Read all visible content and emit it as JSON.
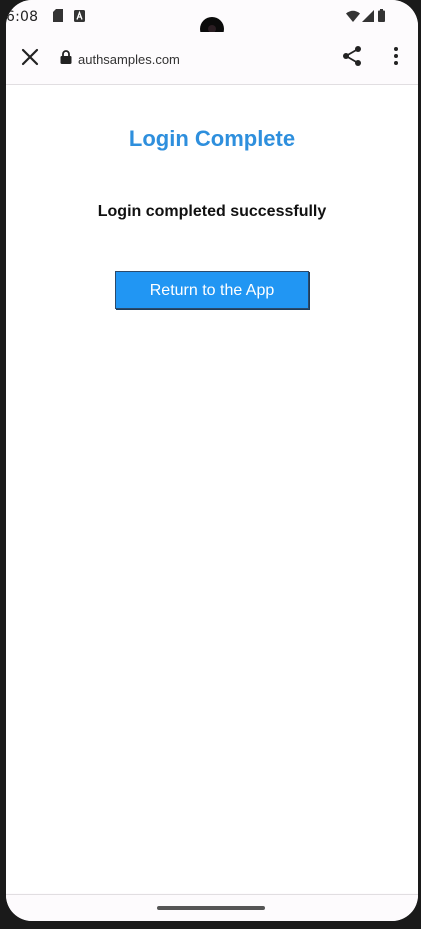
{
  "status_bar": {
    "time": "6:08",
    "icons": [
      "sim-card-icon",
      "keyboard-a-icon",
      "wifi-icon",
      "signal-icon",
      "battery-icon"
    ]
  },
  "toolbar": {
    "close_icon": "close-icon",
    "lock_icon": "lock-icon",
    "url": "authsamples.com",
    "share_icon": "share-icon",
    "menu_icon": "more-vert-icon"
  },
  "page": {
    "title": "Login Complete",
    "message": "Login completed successfully",
    "button_label": "Return to the App"
  },
  "colors": {
    "title": "#2e8fdd",
    "button": "#2196f3",
    "button_text": "#ffffff"
  }
}
